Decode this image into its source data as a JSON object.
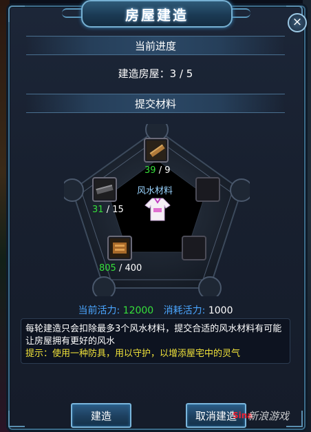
{
  "dialog": {
    "title": "房屋建造",
    "close_icon": "×"
  },
  "progress": {
    "section_title": "当前进度",
    "label": "建造房屋：3 / 5"
  },
  "materials": {
    "section_title": "提交材料",
    "center_label": "风水材料",
    "slots": [
      {
        "name": "wood-plank",
        "have": "39",
        "need": "/ 9"
      },
      {
        "name": "empty",
        "have": "",
        "need": ""
      },
      {
        "name": "empty",
        "have": "",
        "need": ""
      },
      {
        "name": "bronze-armor",
        "have": "805",
        "need": "/ 400"
      },
      {
        "name": "iron-bar",
        "have": "31",
        "need": "/ 15"
      }
    ]
  },
  "energy": {
    "current_label": "当前活力:",
    "current_value": "12000",
    "cost_label": "消耗活力:",
    "cost_value": "1000"
  },
  "description": {
    "main": "每轮建造只会扣除最多3个风水材料，提交合适的风水材料有可能让房屋拥有更好的风水",
    "tip": "提示：使用一种防具，用以守护，以增添屋宅中的灵气"
  },
  "buttons": {
    "build": "建造",
    "cancel": "取消建造"
  },
  "watermark": {
    "logo": "Sina",
    "text": "新浪游戏"
  },
  "colors": {
    "accent": "#7ab6dc",
    "have_count": "#36e03a",
    "energy_label": "#4aa6ff",
    "tip_text": "#f0e23a"
  }
}
